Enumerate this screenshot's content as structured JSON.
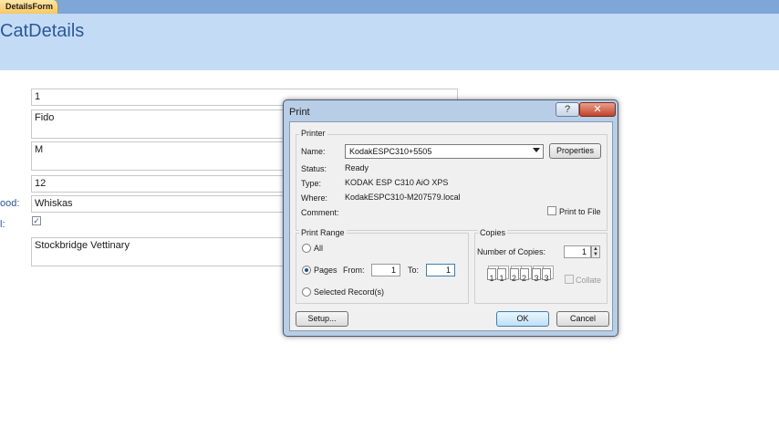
{
  "tab": {
    "label": "DetailsForm"
  },
  "form": {
    "title": "CatDetails",
    "fields": [
      {
        "value": "1"
      },
      {
        "value": "Fido"
      },
      {
        "value": "M"
      },
      {
        "value": "12"
      },
      {
        "label": "ood:",
        "value": "Whiskas"
      },
      {
        "label": "l:",
        "checked": true
      },
      {
        "value": "Stockbridge Vettinary"
      }
    ]
  },
  "dialog": {
    "title": "Print",
    "help_glyph": "?",
    "close_glyph": "✕",
    "printer": {
      "group_label": "Printer",
      "name_label": "Name:",
      "name_value": "KodakESPC310+5505",
      "properties_button": "Properties",
      "status_label": "Status:",
      "status_value": "Ready",
      "type_label": "Type:",
      "type_value": "KODAK ESP C310 AiO XPS",
      "where_label": "Where:",
      "where_value": "KodakESPC310-M207579.local",
      "comment_label": "Comment:",
      "print_to_file_label": "Print to File"
    },
    "range": {
      "group_label": "Print Range",
      "all_label": "All",
      "pages_label": "Pages",
      "from_label": "From:",
      "from_value": "1",
      "to_label": "To:",
      "to_value": "1",
      "selected_label": "Selected Record(s)",
      "selected_option": "Pages"
    },
    "copies": {
      "group_label": "Copies",
      "number_label": "Number of Copies:",
      "number_value": "1",
      "collate_label": "Collate",
      "collate_icon": [
        "1",
        "1",
        "2",
        "2",
        "3",
        "3"
      ]
    },
    "buttons": {
      "setup": "Setup...",
      "ok": "OK",
      "cancel": "Cancel"
    }
  }
}
